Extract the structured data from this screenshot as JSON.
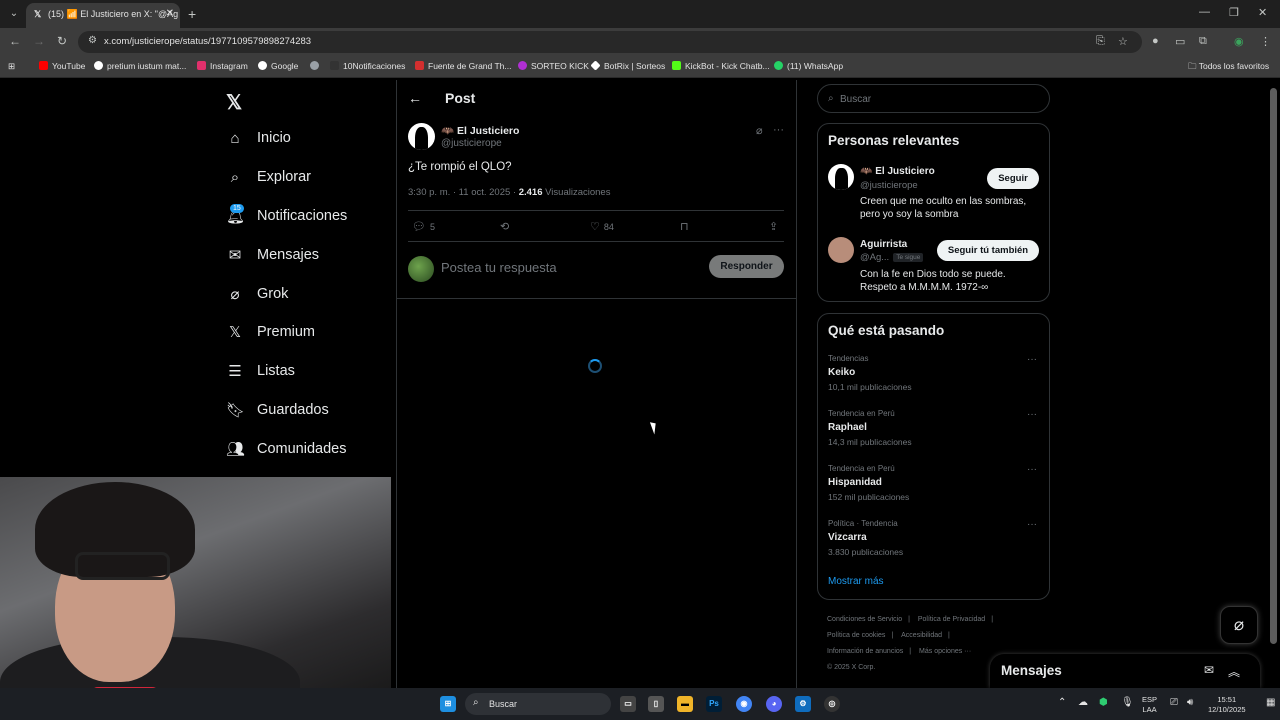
{
  "browser": {
    "tab_title": "(15) 📶 El Justiciero en X: \"@Ag",
    "url": "x.com/justicierope/status/1977109579898274283",
    "bookmarks": [
      {
        "label": "YouTube",
        "color": "#ff0000"
      },
      {
        "label": "pretium iustum mat...",
        "color": "#ffffff"
      },
      {
        "label": "Instagram",
        "color": "#e1306c"
      },
      {
        "label": "Google",
        "color": "#ffffff"
      },
      {
        "label": "",
        "color": "#9aa0a6"
      },
      {
        "label": "10Notificaciones",
        "color": "#e3e3e3"
      },
      {
        "label": "Fuente de Grand Th...",
        "color": "#d32f2f"
      },
      {
        "label": "SORTEO KICK",
        "color": "#b02fd3"
      },
      {
        "label": "BotRix | Sorteos",
        "color": "#ffffff"
      },
      {
        "label": "KickBot - Kick Chatb...",
        "color": "#53fc18"
      },
      {
        "label": "(11) WhatsApp",
        "color": "#25d366"
      }
    ],
    "all_bookmarks": "Todos los favoritos"
  },
  "nav": {
    "items": [
      {
        "label": "Inicio",
        "icon": "home-icon"
      },
      {
        "label": "Explorar",
        "icon": "search-icon"
      },
      {
        "label": "Notificaciones",
        "icon": "bell-icon"
      },
      {
        "label": "Mensajes",
        "icon": "mail-icon"
      },
      {
        "label": "Grok",
        "icon": "grok-icon"
      },
      {
        "label": "Premium",
        "icon": "x-icon"
      },
      {
        "label": "Listas",
        "icon": "list-icon"
      },
      {
        "label": "Guardados",
        "icon": "bookmark-icon"
      },
      {
        "label": "Comunidades",
        "icon": "people-icon"
      }
    ],
    "notif_badge": "15"
  },
  "post": {
    "header": "Post",
    "author_name": "🦇 El Justiciero",
    "author_handle": "@justicierope",
    "text": "¿Te rompió el QLO?",
    "time": "3:30 p. m. · 11 oct. 2025 ·",
    "views_count": "2.416",
    "views_label": "Visualizaciones",
    "replies": "5",
    "likes": "84",
    "reply_placeholder": "Postea tu respuesta",
    "reply_button": "Responder"
  },
  "sidebar": {
    "search_placeholder": "Buscar",
    "relevant_title": "Personas relevantes",
    "people": [
      {
        "name": "🦇 El Justiciero",
        "handle": "@justicierope",
        "bio": "Creen que me oculto en las sombras, pero yo soy la sombra",
        "button": "Seguir"
      },
      {
        "name": "Aguirrista",
        "handle": "@Ag...",
        "follows_you": "Te sigue",
        "bio": "Con la fe en Dios todo se puede. Respeto a M.M.M.M. 1972-∞",
        "button": "Seguir tú también"
      }
    ],
    "trending_title": "Qué está pasando",
    "trends": [
      {
        "category": "Tendencias",
        "name": "Keiko",
        "count": "10,1 mil publicaciones"
      },
      {
        "category": "Tendencia en Perú",
        "name": "Raphael",
        "count": "14,3 mil publicaciones"
      },
      {
        "category": "Tendencia en Perú",
        "name": "Hispanidad",
        "count": "152 mil publicaciones"
      },
      {
        "category": "Política · Tendencia",
        "name": "Vizcarra",
        "count": "3.830 publicaciones"
      }
    ],
    "show_more": "Mostrar más",
    "footer": [
      "Condiciones de Servicio",
      "Política de Privacidad",
      "Política de cookies",
      "Accesibilidad",
      "Información de anuncios",
      "Más opciones ···",
      "© 2025 X Corp."
    ]
  },
  "messages_drawer": {
    "title": "Mensajes"
  },
  "taskbar": {
    "search": "Buscar",
    "lang_line1": "ESP",
    "lang_line2": "LAA",
    "time": "15:51",
    "date": "12/10/2025"
  },
  "colors": {
    "accent": "#1d9bf0",
    "background": "#000000",
    "border": "#2f3336",
    "muted": "#71767b"
  }
}
